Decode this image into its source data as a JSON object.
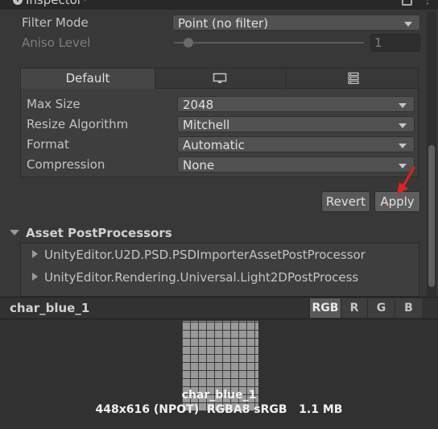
{
  "window": {
    "title": "Inspector*"
  },
  "rows": {
    "filter_mode": {
      "label": "Filter Mode",
      "value": "Point (no filter)"
    },
    "aniso_level": {
      "label": "Aniso Level",
      "value": "1"
    }
  },
  "platform_tabs": [
    {
      "label": "Default",
      "icon": "default-tab"
    },
    {
      "label": "",
      "icon": "monitor-icon"
    },
    {
      "label": "",
      "icon": "server-icon"
    }
  ],
  "platform_settings": {
    "max_size": {
      "label": "Max Size",
      "value": "2048"
    },
    "resize_algorithm": {
      "label": "Resize Algorithm",
      "value": "Mitchell"
    },
    "format": {
      "label": "Format",
      "value": "Automatic"
    },
    "compression": {
      "label": "Compression",
      "value": "None"
    }
  },
  "actions": {
    "revert": "Revert",
    "apply": "Apply"
  },
  "postprocessors": {
    "title": "Asset PostProcessors",
    "items": [
      "UnityEditor.U2D.PSD.PSDImporterAssetPostProcessor",
      "UnityEditor.Rendering.Universal.Light2DPostProcess"
    ]
  },
  "preview": {
    "asset_name": "char_blue_1",
    "channels": [
      "RGB",
      "R",
      "G",
      "B"
    ],
    "caption_name": "char_blue_1",
    "info": "448x616 (NPOT)  RGBA8 sRGB   1.1 MB"
  },
  "colors": {
    "background": "#383838",
    "panel": "#3e3e3e",
    "dropdown": "#515151",
    "annotation_arrow": "#e02020"
  }
}
